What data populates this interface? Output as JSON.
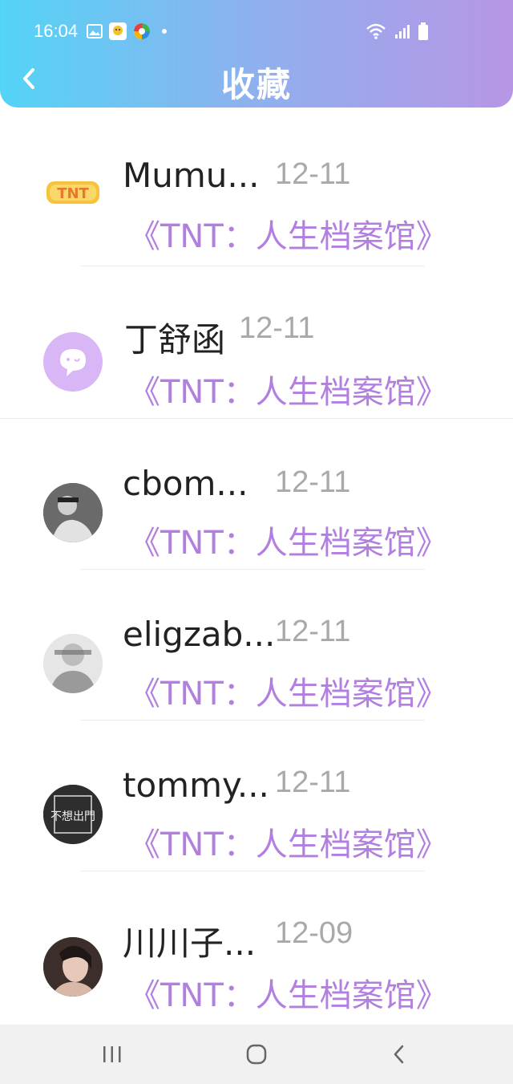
{
  "status_bar": {
    "time": "16:04"
  },
  "header": {
    "title": "收藏"
  },
  "items": [
    {
      "name": "Mumu...",
      "date": "12-11",
      "link": "《TNT：人生档案馆》"
    },
    {
      "name": "丁舒函",
      "date": "12-11",
      "link": "《TNT：人生档案馆》"
    },
    {
      "name": "cbom...",
      "date": "12-11",
      "link": "《TNT：人生档案馆》"
    },
    {
      "name": "eligzab...",
      "date": "12-11",
      "link": "《TNT：人生档案馆》"
    },
    {
      "name": "tommy...",
      "date": "12-11",
      "link": "《TNT：人生档案馆》"
    },
    {
      "name": "川川子...",
      "date": "12-09",
      "link": "《TNT：人生档案馆》"
    }
  ],
  "avatars": {
    "tnt_logo_text": "TNT",
    "poster_text": "不想出門"
  },
  "colors": {
    "header_gradient_start": "#53d4f6",
    "header_gradient_end": "#b796e6",
    "link": "#b27ee0",
    "date": "#a9a9a9"
  }
}
